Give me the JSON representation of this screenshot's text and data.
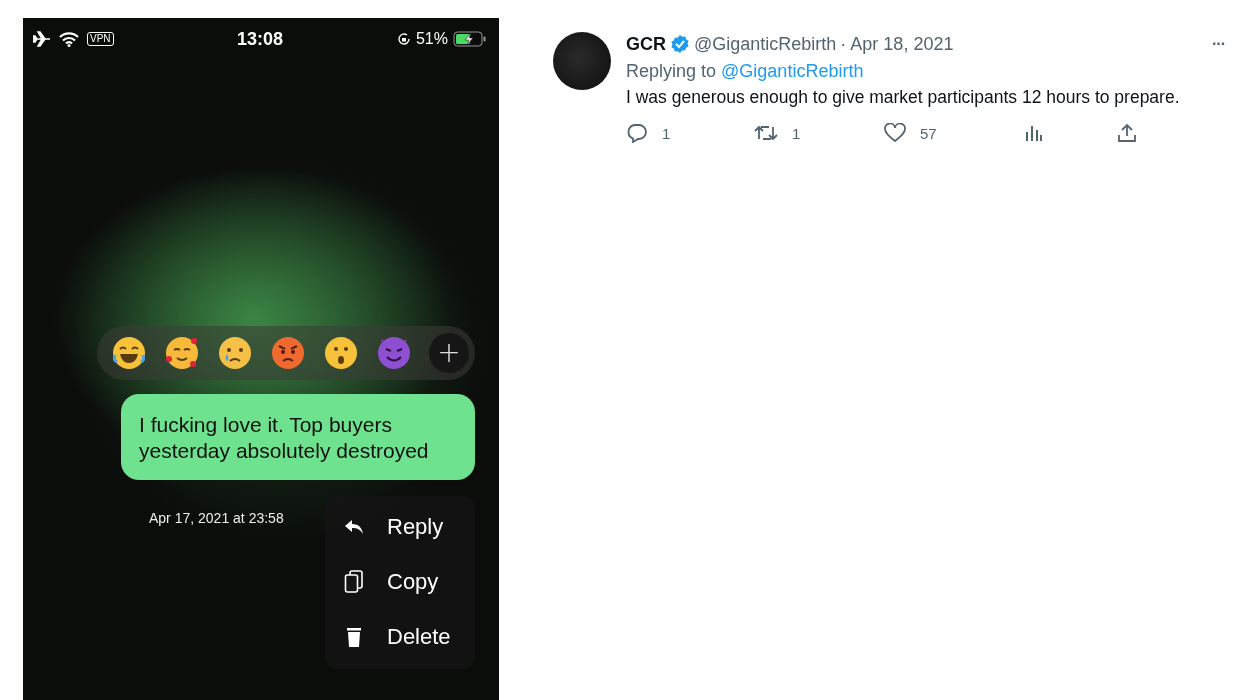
{
  "phone": {
    "status_bar": {
      "vpn": "VPN",
      "time": "13:08",
      "battery": "51%"
    },
    "reactions": [
      {
        "kind": "joy"
      },
      {
        "kind": "love"
      },
      {
        "kind": "cry"
      },
      {
        "kind": "angry"
      },
      {
        "kind": "wow"
      },
      {
        "kind": "devil"
      },
      {
        "kind": "more",
        "label": "+"
      }
    ],
    "message": {
      "text": "I fucking love it. Top buyers yesterday absolutely destroyed",
      "timestamp": "Apr 17, 2021 at 23:58"
    },
    "menu": [
      {
        "kind": "reply",
        "label": "Reply"
      },
      {
        "kind": "copy",
        "label": "Copy"
      },
      {
        "kind": "delete",
        "label": "Delete"
      }
    ]
  },
  "tweet": {
    "name": "GCR",
    "verified": true,
    "handle": "@GiganticRebirth",
    "separator": "·",
    "date": "Apr 18, 2021",
    "replying_prefix": "Replying to",
    "replying_handle": "@GiganticRebirth",
    "more": "···",
    "text": "I was generous enough to give market participants 12 hours to prepare.",
    "actions": [
      {
        "kind": "reply",
        "count": "1"
      },
      {
        "kind": "retweet",
        "count": "1"
      },
      {
        "kind": "like",
        "count": "57"
      },
      {
        "kind": "views"
      },
      {
        "kind": "share"
      }
    ]
  }
}
